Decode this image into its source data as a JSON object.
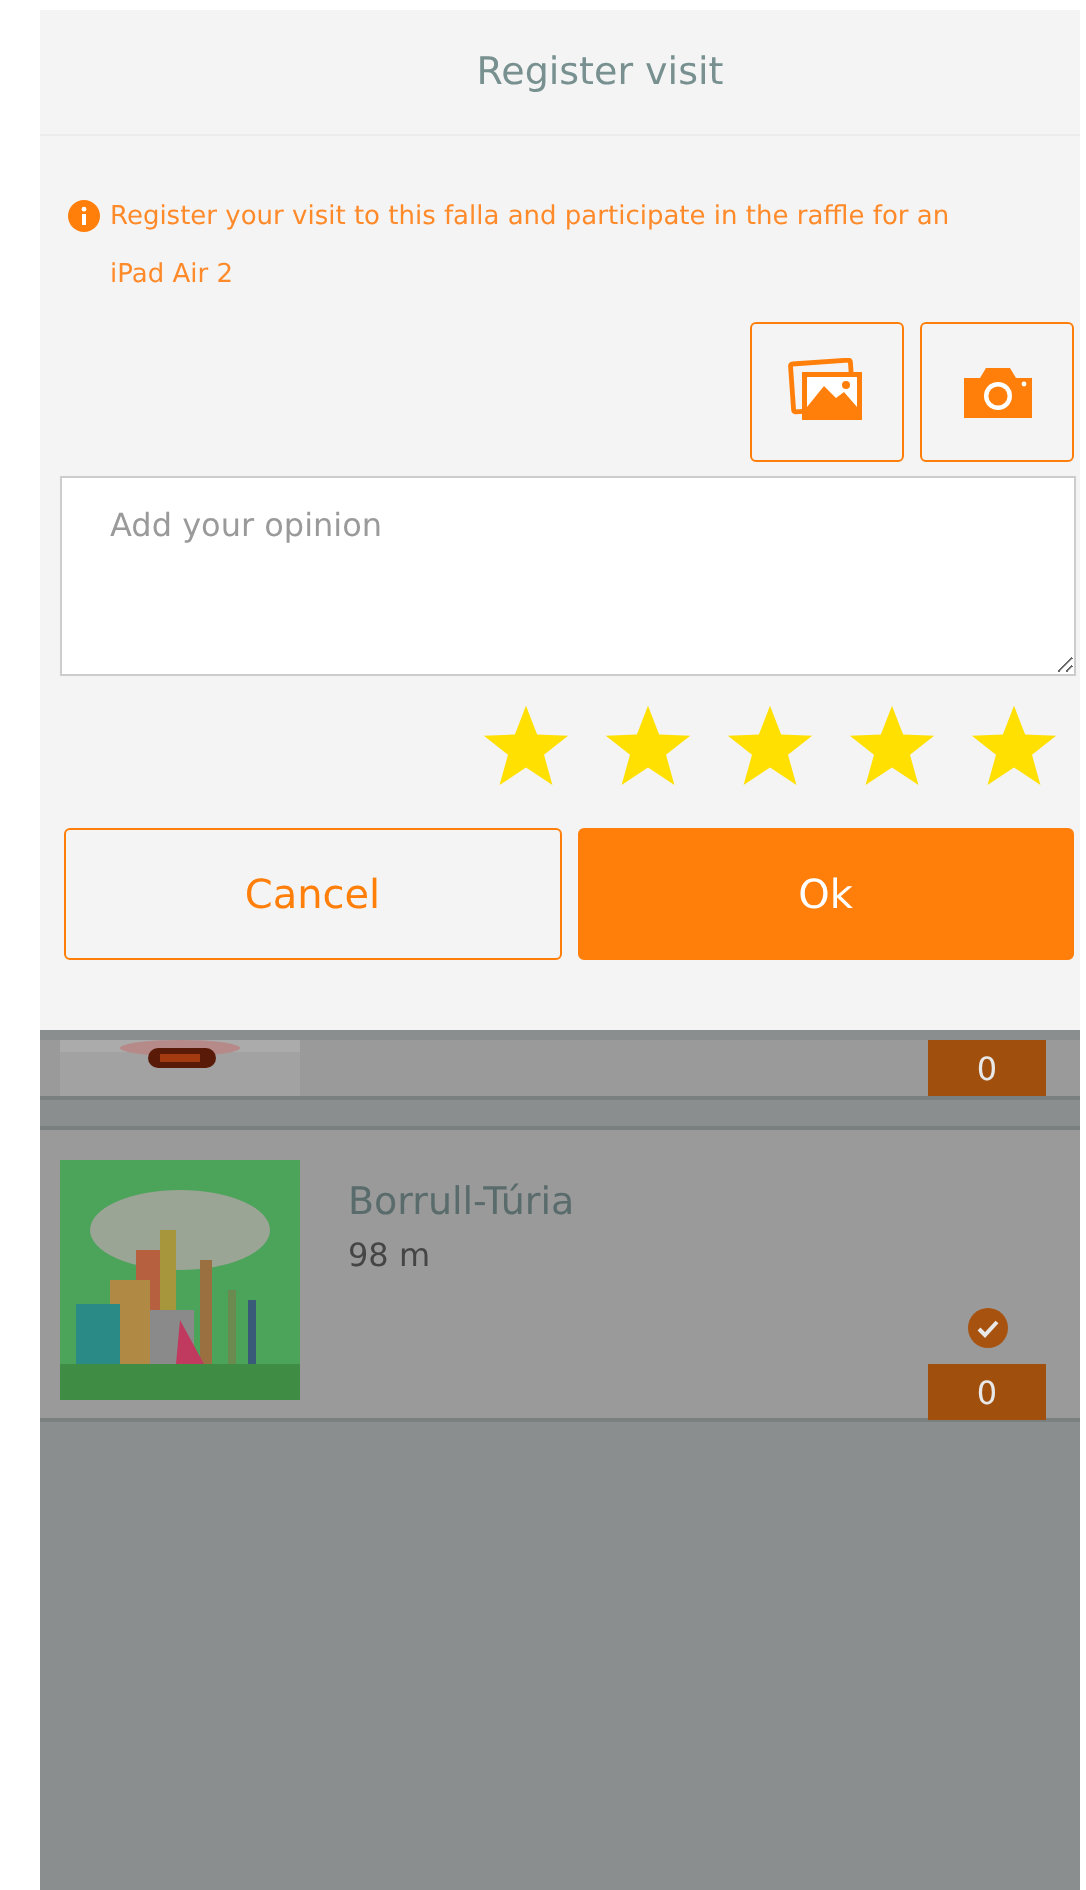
{
  "dialog": {
    "title": "Register visit",
    "info": "Register your visit to this falla and participate in the raffle for an iPad Air 2",
    "opinion": {
      "placeholder": "Add your opinion"
    },
    "stars": 5,
    "buttons": [
      {
        "label": "Cancel",
        "kind": "secondary"
      },
      {
        "label": "Ok",
        "kind": "primary"
      }
    ]
  },
  "list": [
    {
      "kind": "partial",
      "count": "0"
    },
    {
      "kind": "full",
      "name": "Borrull-Túria",
      "distance": "98 m",
      "count": "0",
      "visited": true
    }
  ]
}
